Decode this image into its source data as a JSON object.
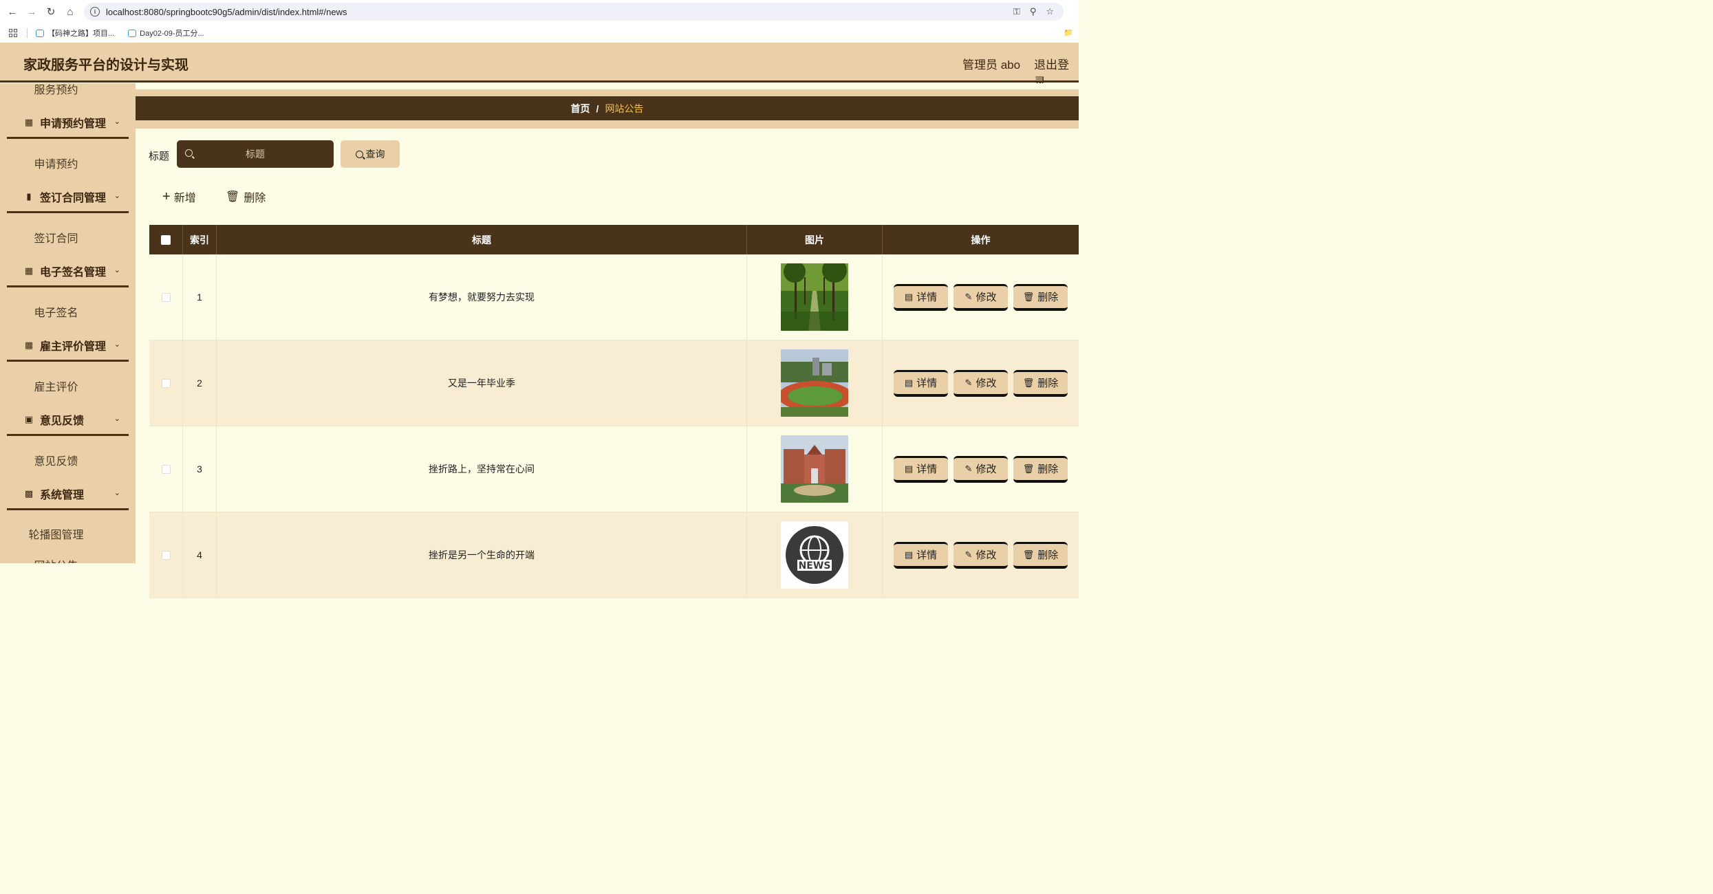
{
  "browser": {
    "url": "localhost:8080/springbootc90g5/admin/dist/index.html#/news",
    "bookmarks": [
      "【码神之路】项目...",
      "Day02-09-员工分..."
    ]
  },
  "header": {
    "title": "家政服务平台的设计与实现",
    "user": "管理员 abo",
    "logout": "退出登录"
  },
  "sidebar": {
    "top_partial": "服务预约",
    "groups": [
      {
        "title": "申请预约管理",
        "icon": "grid-icon",
        "item": "申请预约"
      },
      {
        "title": "签订合同管理",
        "icon": "book-icon",
        "item": "签订合同"
      },
      {
        "title": "电子签名管理",
        "icon": "grid-icon",
        "item": "电子签名"
      },
      {
        "title": "雇主评价管理",
        "icon": "grid-icon",
        "item": "雇主评价"
      },
      {
        "title": "意见反馈",
        "icon": "monitor-icon",
        "item": "意见反馈"
      },
      {
        "title": "系统管理",
        "icon": "apps-icon",
        "item": "轮播图管理"
      }
    ],
    "bottom_partial": "网站公告"
  },
  "breadcrumb": {
    "home": "首页",
    "sep": "/",
    "current": "网站公告"
  },
  "search": {
    "label": "标题",
    "placeholder": "标题",
    "button": "查询"
  },
  "actions": {
    "add": "新增",
    "delete": "删除"
  },
  "table": {
    "columns": [
      "索引",
      "标题",
      "图片",
      "操作"
    ],
    "rows": [
      {
        "index": "1",
        "title": "有梦想，就要努力去实现",
        "image": "tree-lined-path"
      },
      {
        "index": "2",
        "title": "又是一年毕业季",
        "image": "campus-track"
      },
      {
        "index": "3",
        "title": "挫折路上，坚持常在心间",
        "image": "campus-building"
      },
      {
        "index": "4",
        "title": "挫折是另一个生命的开端",
        "image": "news-globe"
      }
    ],
    "ops": {
      "detail": "详情",
      "edit": "修改",
      "delete": "删除"
    }
  },
  "colors": {
    "dark_brown": "#4a331b",
    "tan": "#ead0a8",
    "cream": "#fdfce6",
    "accent_yellow": "#f5c04a"
  }
}
